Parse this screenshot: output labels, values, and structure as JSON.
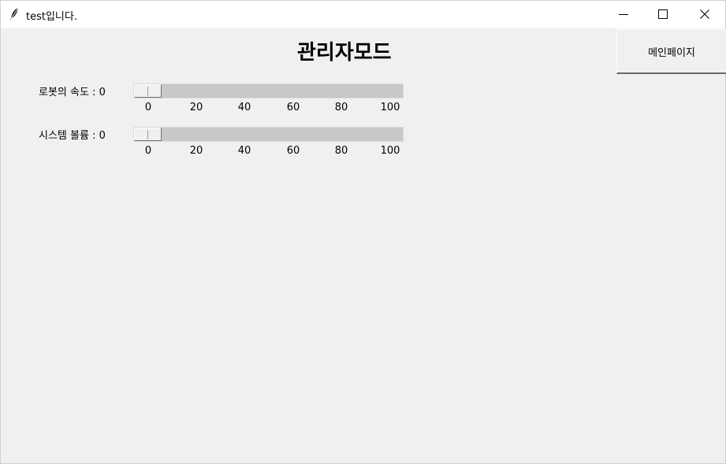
{
  "window": {
    "title": "test입니다."
  },
  "page_title": "관리자모드",
  "main_page_button": "메인페이지",
  "sliders": [
    {
      "label": "로봇의 속도 : 0",
      "value": 0,
      "min": 0,
      "max": 100
    },
    {
      "label": "시스템 볼륨 : 0",
      "value": 0,
      "min": 0,
      "max": 100
    }
  ],
  "ticks": [
    "0",
    "20",
    "40",
    "60",
    "80",
    "100"
  ]
}
